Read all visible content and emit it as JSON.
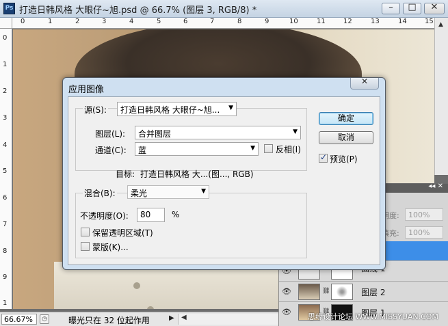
{
  "window": {
    "title": "打造日韩风格 大眼仔~旭.psd @ 66.7% (图层 3, RGB/8) *",
    "app_icon": "Ps"
  },
  "rulers": {
    "top_labels": [
      "0",
      "1",
      "2",
      "3",
      "4",
      "5",
      "6",
      "7",
      "8",
      "9",
      "10",
      "11",
      "12",
      "13",
      "14",
      "15"
    ],
    "left_labels": [
      "0",
      "1",
      "2",
      "3",
      "4",
      "5",
      "6",
      "7",
      "8",
      "9",
      "1"
    ]
  },
  "dialog": {
    "title": "应用图像",
    "source_label": "源(S):",
    "source_value": "打造日韩风格 大眼仔~旭...",
    "layer_label": "图层(L):",
    "layer_value": "合并图层",
    "channel_label": "通道(C):",
    "channel_value": "蓝",
    "invert_label": "反相(I)",
    "invert_checked": false,
    "target_label": "目标:",
    "target_value": "打造日韩风格 大...(图..., RGB)",
    "blending_label": "混合(B):",
    "blending_value": "柔光",
    "opacity_label": "不透明度(O):",
    "opacity_value": "80",
    "opacity_unit": "%",
    "preserve_transparency_label": "保留透明区域(T)",
    "preserve_transparency_checked": false,
    "mask_label": "蒙版(K)...",
    "mask_checked": false,
    "ok_label": "确定",
    "cancel_label": "取消",
    "preview_label": "预览(P)",
    "preview_checked": true
  },
  "layers_panel": {
    "opacity_label": "明度:",
    "opacity_value": "100%",
    "fill_label": "填充:",
    "fill_value": "100%",
    "layers": [
      {
        "name": "曲线 1"
      },
      {
        "name": "图层 2"
      },
      {
        "name": "图层 1"
      }
    ]
  },
  "status_bar": {
    "zoom": "66.67%",
    "message": "曝光只在 32 位起作用"
  },
  "watermark": "思缘设计论坛 WWW.MISSYUAN.COM"
}
